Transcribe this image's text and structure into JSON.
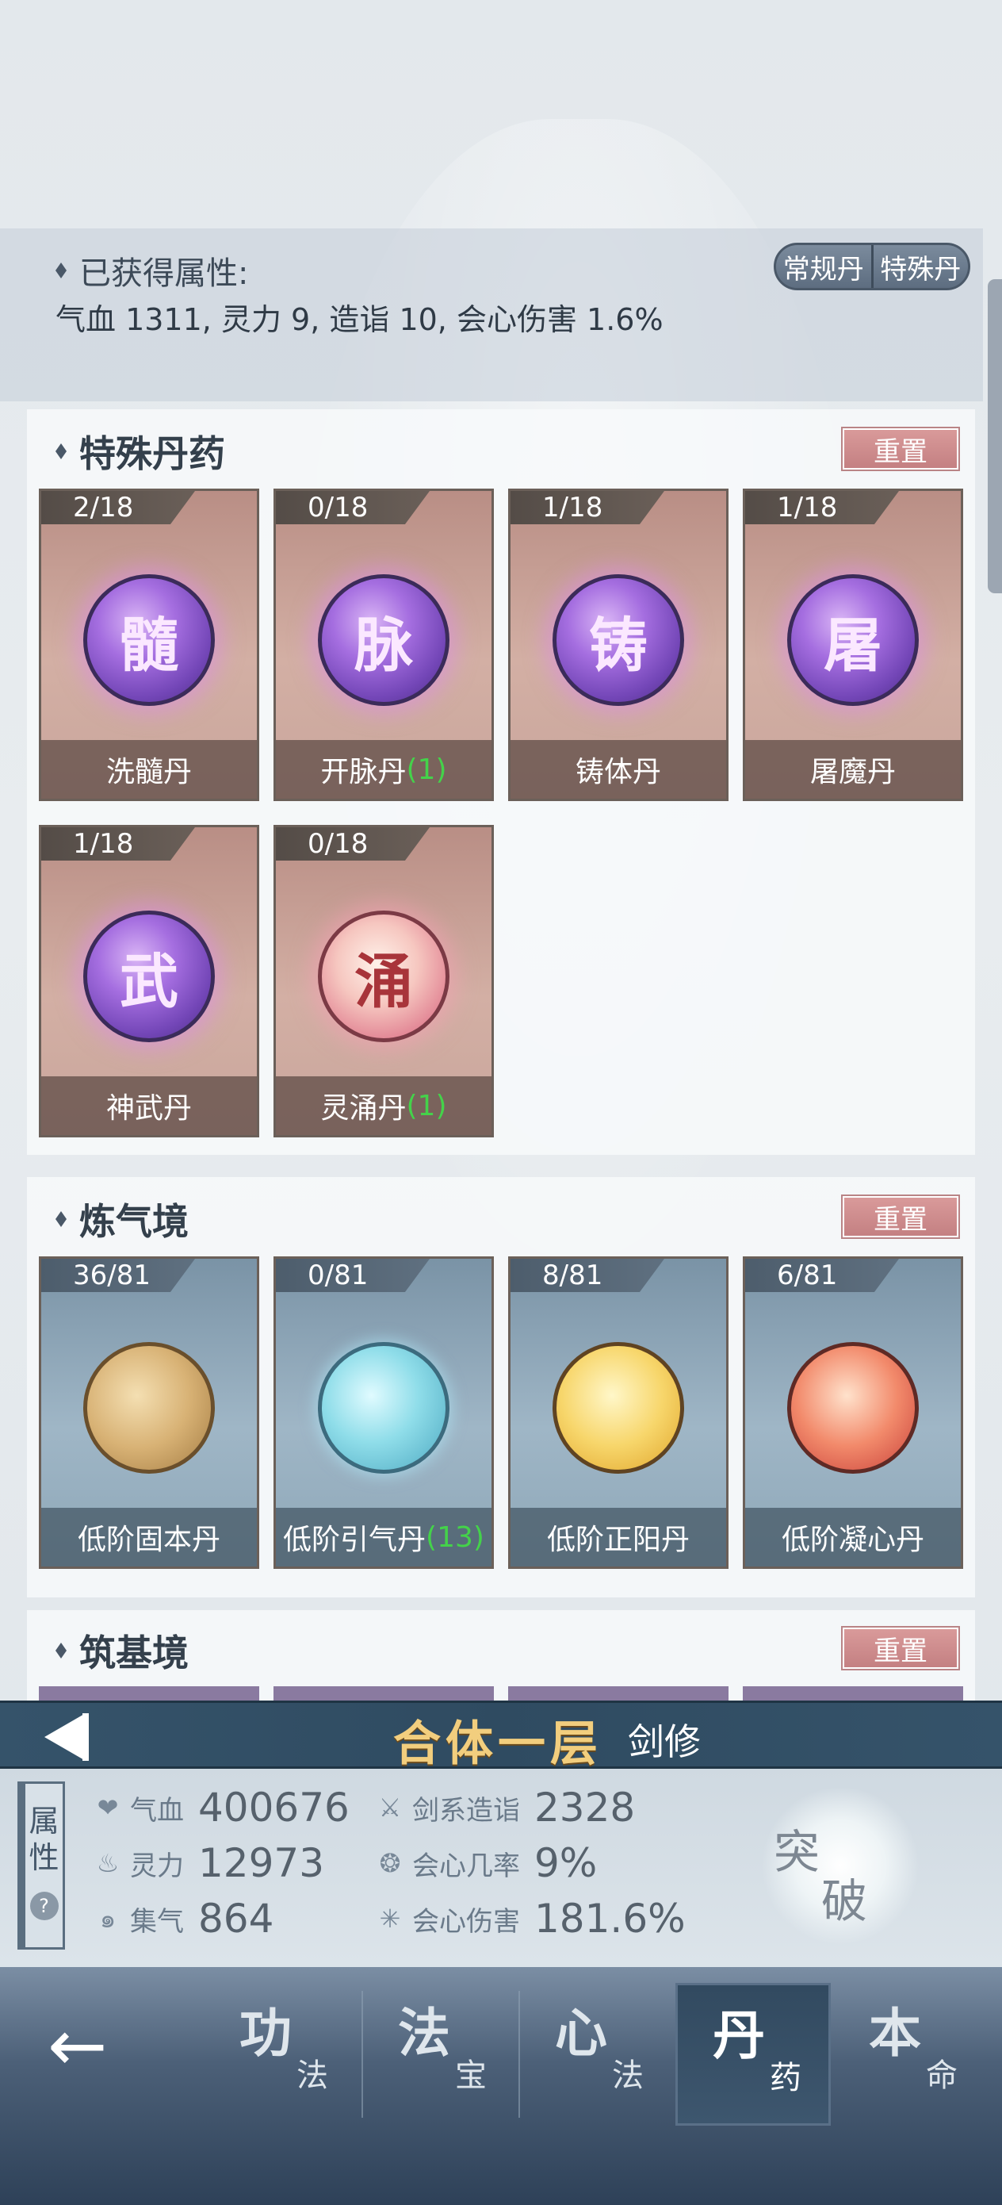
{
  "attributes": {
    "title": "已获得属性:",
    "summary": "气血 1311, 灵力 9, 造诣 10, 会心伤害 1.6%",
    "toggle": [
      "常规丹",
      "特殊丹"
    ]
  },
  "sections": [
    {
      "title": "特殊丹药",
      "reset": "重置",
      "cards": [
        {
          "count": "2/18",
          "glyph": "髓",
          "name": "洗髓丹",
          "extra": ""
        },
        {
          "count": "0/18",
          "glyph": "脉",
          "name": "开脉丹",
          "extra": "(1)"
        },
        {
          "count": "1/18",
          "glyph": "铸",
          "name": "铸体丹",
          "extra": ""
        },
        {
          "count": "1/18",
          "glyph": "屠",
          "name": "屠魔丹",
          "extra": ""
        },
        {
          "count": "1/18",
          "glyph": "武",
          "name": "神武丹",
          "extra": ""
        },
        {
          "count": "0/18",
          "glyph": "涌",
          "name": "灵涌丹",
          "extra": "(1)"
        }
      ]
    },
    {
      "title": "炼气境",
      "reset": "重置",
      "cards": [
        {
          "count": "36/81",
          "name": "低阶固本丹",
          "extra": ""
        },
        {
          "count": "0/81",
          "name": "低阶引气丹",
          "extra": "(13)"
        },
        {
          "count": "8/81",
          "name": "低阶正阳丹",
          "extra": ""
        },
        {
          "count": "6/81",
          "name": "低阶凝心丹",
          "extra": ""
        }
      ]
    },
    {
      "title": "筑基境",
      "reset": "重置"
    }
  ],
  "stage": {
    "name": "合体一层",
    "class": "剑修"
  },
  "stats": {
    "tab_label": [
      "属",
      "性"
    ],
    "help": "?",
    "items": [
      {
        "icon": "heart-icon",
        "label": "气血",
        "value": "400676"
      },
      {
        "icon": "sword-icon",
        "label": "剑系造诣",
        "value": "2328"
      },
      {
        "icon": "flame-icon",
        "label": "灵力",
        "value": "12973"
      },
      {
        "icon": "crit-rate-icon",
        "label": "会心几率",
        "value": "9%"
      },
      {
        "icon": "swirl-icon",
        "label": "集气",
        "value": "864"
      },
      {
        "icon": "burst-icon",
        "label": "会心伤害",
        "value": "181.6%"
      }
    ],
    "breakthrough": [
      "突",
      "破"
    ]
  },
  "tabs": [
    {
      "big": "功",
      "small": "法"
    },
    {
      "big": "法",
      "small": "宝"
    },
    {
      "big": "心",
      "small": "法"
    },
    {
      "big": "丹",
      "small": "药",
      "active": true
    },
    {
      "big": "本",
      "small": "命"
    }
  ]
}
